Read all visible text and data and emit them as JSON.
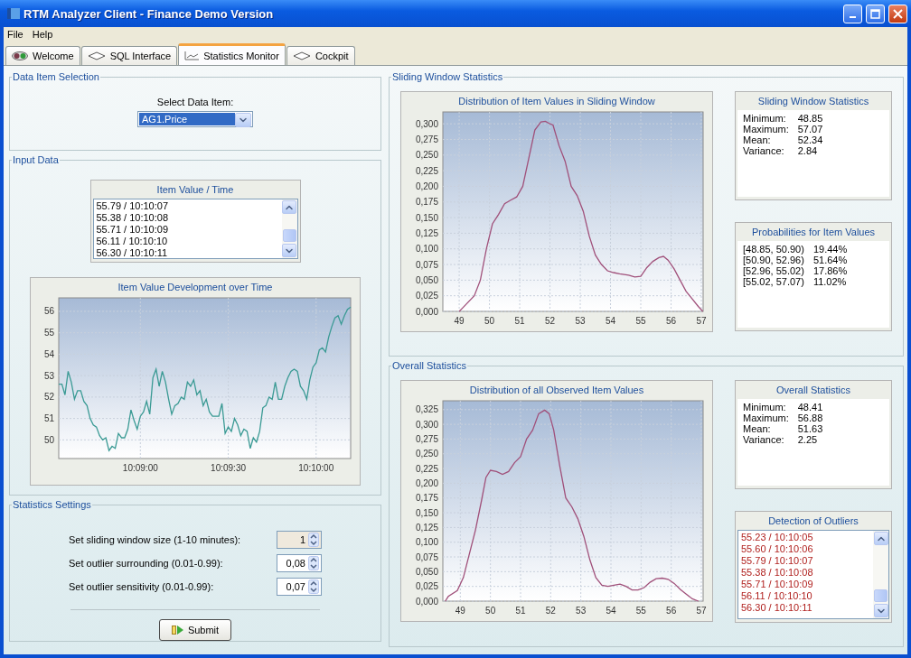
{
  "window": {
    "title": "RTM Analyzer Client - Finance Demo Version"
  },
  "menu": [
    "File",
    "Help"
  ],
  "tabs": [
    {
      "label": "Welcome",
      "kind": "welcome",
      "selected": false
    },
    {
      "label": "SQL Interface",
      "kind": "diamond",
      "selected": false
    },
    {
      "label": "Statistics Monitor",
      "kind": "chart",
      "selected": true
    },
    {
      "label": "Cockpit",
      "kind": "diamond",
      "selected": false
    }
  ],
  "data_item_selection": {
    "title": "Data Item Selection",
    "label": "Select Data Item:",
    "value": "AG1.Price"
  },
  "input_data": {
    "title": "Input Data",
    "list": {
      "title": "Item Value / Time",
      "items": [
        "55.79 / 10:10:07",
        "55.38 / 10:10:08",
        "55.71 / 10:10:09",
        "56.11 / 10:10:10",
        "56.30 / 10:10:11"
      ]
    },
    "chart": {
      "title": "Item Value Development over Time",
      "chart_data": {
        "type": "line",
        "categories": [
          null,
          null,
          null,
          null,
          null,
          null,
          null,
          null,
          null,
          null,
          null,
          null,
          null,
          null,
          null,
          null,
          null,
          null,
          null,
          null,
          null,
          null,
          null,
          null,
          null,
          null,
          "10:09:00",
          null,
          null,
          null,
          null,
          null,
          null,
          null,
          null,
          null,
          null,
          null,
          null,
          null,
          null,
          null,
          null,
          null,
          null,
          null,
          null,
          null,
          null,
          null,
          null,
          null,
          null,
          null,
          "10:09:30",
          null,
          null,
          null,
          null,
          null,
          null,
          null,
          null,
          null,
          null,
          null,
          null,
          null,
          null,
          null,
          null,
          null,
          null,
          null,
          null,
          null,
          null,
          null,
          null,
          null,
          null,
          null,
          "10:10:00",
          null,
          null,
          null,
          null,
          null,
          null,
          null,
          null,
          null,
          null,
          null
        ],
        "series": [
          {
            "color": "#3a9a94",
            "values": [
              52.6,
              52.6,
              52.1,
              53.2,
              52.7,
              51.9,
              52.3,
              52.3,
              51.8,
              51.6,
              51,
              50.7,
              50.6,
              50.2,
              50,
              50.1,
              49.5,
              49.7,
              49.6,
              50.3,
              50.1,
              50.1,
              50.5,
              51.4,
              50.9,
              50.5,
              51.1,
              51.3,
              51.8,
              51.2,
              52.9,
              53.3,
              52.5,
              53.2,
              52.7,
              51.9,
              51.2,
              51.6,
              51.7,
              52,
              51.9,
              52.7,
              52.5,
              52.8,
              52.1,
              52.3,
              51.6,
              51.9,
              51.3,
              51.1,
              51.1,
              51.1,
              51.7,
              50.3,
              50.6,
              50.4,
              51,
              50.7,
              50.2,
              50.5,
              50.4,
              49.6,
              50.1,
              49.9,
              50.4,
              51.5,
              51.6,
              52,
              51.9,
              52.7,
              51.9,
              51.9,
              52.5,
              52.9,
              53.2,
              53.3,
              53.2,
              52.5,
              52.3,
              51.9,
              52.8,
              53.4,
              53.6,
              54.2,
              54.3,
              54.1,
              54.8,
              55.3,
              55.7,
              55.8,
              55.4,
              55.8,
              56.1,
              56.2
            ]
          }
        ],
        "ylim": [
          49.13,
          56.63
        ],
        "grid": true,
        "yticks": [
          50,
          51,
          52,
          53,
          54,
          55,
          56
        ]
      }
    }
  },
  "statistics_settings": {
    "title": "Statistics Settings",
    "fields": [
      {
        "label": "Set sliding window size (1-10 minutes):",
        "value": "1",
        "disabled": true
      },
      {
        "label": "Set outlier surrounding (0.01-0.99):",
        "value": "0,08",
        "disabled": false
      },
      {
        "label": "Set outlier sensitivity (0.01-0.99):",
        "value": "0,07",
        "disabled": false
      }
    ],
    "submit": "Submit"
  },
  "sliding_window": {
    "title": "Sliding Window Statistics",
    "chart": {
      "title": "Distribution of Item Values in Sliding Window",
      "chart_data": {
        "type": "line",
        "x": [
          49,
          49.2,
          49.5,
          49.7,
          49.9,
          50.1,
          50.3,
          50.5,
          50.7,
          50.9,
          51.1,
          51.3,
          51.5,
          51.7,
          51.85,
          52,
          52.1,
          52.3,
          52.5,
          52.7,
          52.9,
          53.1,
          53.3,
          53.5,
          53.7,
          53.9,
          54.1,
          54.3,
          54.6,
          54.8,
          55,
          55.2,
          55.4,
          55.6,
          55.75,
          55.9,
          56.1,
          56.3,
          56.5,
          56.7,
          56.9,
          57.05
        ],
        "series": [
          {
            "color": "#a0507a",
            "values": [
              0,
              0.01,
              0.025,
              0.05,
              0.1,
              0.14,
              0.155,
              0.172,
              0.178,
              0.183,
              0.2,
              0.245,
              0.29,
              0.303,
              0.304,
              0.3,
              0.298,
              0.265,
              0.24,
              0.2,
              0.185,
              0.16,
              0.12,
              0.09,
              0.075,
              0.065,
              0.062,
              0.06,
              0.058,
              0.055,
              0.056,
              0.07,
              0.08,
              0.086,
              0.088,
              0.082,
              0.068,
              0.05,
              0.032,
              0.02,
              0.008,
              0
            ]
          }
        ],
        "xlim": [
          48.46,
          57.06
        ],
        "ylim": [
          0,
          0.319
        ],
        "grid": true,
        "xticks": [
          49,
          50,
          51,
          52,
          53,
          54,
          55,
          56,
          57
        ],
        "yticks": [
          {
            "value": 0,
            "label": "0,000"
          },
          {
            "value": 0.025,
            "label": "0,025"
          },
          {
            "value": 0.05,
            "label": "0,050"
          },
          {
            "value": 0.075,
            "label": "0,075"
          },
          {
            "value": 0.1,
            "label": "0,100"
          },
          {
            "value": 0.125,
            "label": "0,125"
          },
          {
            "value": 0.15,
            "label": "0,150"
          },
          {
            "value": 0.175,
            "label": "0,175"
          },
          {
            "value": 0.2,
            "label": "0,200"
          },
          {
            "value": 0.225,
            "label": "0,225"
          },
          {
            "value": 0.25,
            "label": "0,250"
          },
          {
            "value": 0.275,
            "label": "0,275"
          },
          {
            "value": 0.3,
            "label": "0,300"
          }
        ]
      }
    },
    "stats": {
      "title": "Sliding Window Statistics",
      "rows": [
        {
          "label": "Minimum:",
          "value": "48.85"
        },
        {
          "label": "Maximum:",
          "value": "57.07"
        },
        {
          "label": "Mean:",
          "value": "52.34"
        },
        {
          "label": "Variance:",
          "value": "2.84"
        }
      ]
    },
    "probabilities": {
      "title": "Probabilities for Item Values",
      "rows": [
        {
          "label": "[48.85, 50.90)",
          "value": "19.44%"
        },
        {
          "label": "[50.90, 52.96)",
          "value": "51.64%"
        },
        {
          "label": "[52.96, 55.02)",
          "value": "17.86%"
        },
        {
          "label": "[55.02, 57.07)",
          "value": "11.02%"
        }
      ]
    }
  },
  "overall": {
    "title": "Overall Statistics",
    "chart": {
      "title": "Distribution of all Observed Item Values",
      "chart_data": {
        "type": "line",
        "x": [
          48.5,
          48.6,
          48.9,
          49.1,
          49.3,
          49.5,
          49.7,
          49.85,
          50,
          50.2,
          50.4,
          50.6,
          50.8,
          51,
          51.2,
          51.4,
          51.6,
          51.8,
          51.95,
          52.1,
          52.3,
          52.5,
          52.7,
          52.9,
          53.1,
          53.3,
          53.5,
          53.7,
          53.9,
          54.1,
          54.3,
          54.5,
          54.7,
          54.9,
          55.1,
          55.3,
          55.5,
          55.7,
          55.9,
          56.1,
          56.3,
          56.5,
          56.7,
          56.9
        ],
        "series": [
          {
            "color": "#a0507a",
            "values": [
              0,
              0.008,
              0.018,
              0.04,
              0.08,
              0.12,
              0.17,
              0.21,
              0.222,
              0.22,
              0.215,
              0.22,
              0.235,
              0.245,
              0.275,
              0.29,
              0.318,
              0.324,
              0.318,
              0.29,
              0.23,
              0.175,
              0.16,
              0.14,
              0.11,
              0.07,
              0.04,
              0.027,
              0.025,
              0.027,
              0.029,
              0.025,
              0.019,
              0.019,
              0.023,
              0.032,
              0.038,
              0.039,
              0.037,
              0.03,
              0.02,
              0.012,
              0.004,
              0
            ]
          }
        ],
        "xlim": [
          48.42,
          57.06
        ],
        "ylim": [
          0,
          0.34
        ],
        "grid": true,
        "xticks": [
          49,
          50,
          51,
          52,
          53,
          54,
          55,
          56,
          57
        ],
        "yticks": [
          {
            "value": 0,
            "label": "0,000"
          },
          {
            "value": 0.025,
            "label": "0,025"
          },
          {
            "value": 0.05,
            "label": "0,050"
          },
          {
            "value": 0.075,
            "label": "0,075"
          },
          {
            "value": 0.1,
            "label": "0,100"
          },
          {
            "value": 0.125,
            "label": "0,125"
          },
          {
            "value": 0.15,
            "label": "0,150"
          },
          {
            "value": 0.175,
            "label": "0,175"
          },
          {
            "value": 0.2,
            "label": "0,200"
          },
          {
            "value": 0.225,
            "label": "0,225"
          },
          {
            "value": 0.25,
            "label": "0,250"
          },
          {
            "value": 0.275,
            "label": "0,275"
          },
          {
            "value": 0.3,
            "label": "0,300"
          },
          {
            "value": 0.325,
            "label": "0,325"
          }
        ]
      }
    },
    "stats": {
      "title": "Overall Statistics",
      "rows": [
        {
          "label": "Minimum:",
          "value": "48.41"
        },
        {
          "label": "Maximum:",
          "value": "56.88"
        },
        {
          "label": "Mean:",
          "value": "51.63"
        },
        {
          "label": "Variance:",
          "value": "2.25"
        }
      ]
    },
    "outliers": {
      "title": "Detection of Outliers",
      "items": [
        "55.23 / 10:10:05",
        "55.60 / 10:10:06",
        "55.79 / 10:10:07",
        "55.38 / 10:10:08",
        "55.71 / 10:10:09",
        "56.11 / 10:10:10",
        "56.30 / 10:10:11"
      ]
    }
  }
}
